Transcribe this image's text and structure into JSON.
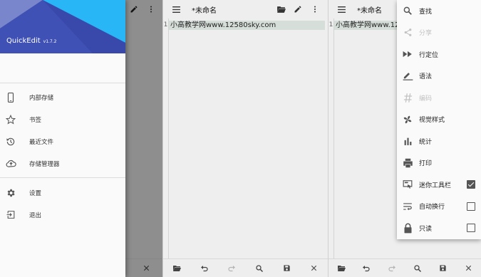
{
  "app": {
    "name": "QuickEdit",
    "version": "v1.7.2"
  },
  "drawer": {
    "storage_items": [
      {
        "label": "内部存储",
        "icon": "phone-icon"
      },
      {
        "label": "书签",
        "icon": "star-icon"
      },
      {
        "label": "最近文件",
        "icon": "history-icon"
      },
      {
        "label": "存储管理器",
        "icon": "cloud-upload-icon"
      }
    ],
    "other_items": [
      {
        "label": "设置",
        "icon": "gear-icon"
      },
      {
        "label": "退出",
        "icon": "exit-icon"
      }
    ]
  },
  "editors": [
    {
      "title": "*未命名",
      "line_number": "1",
      "line_text": "小高教学网www.12580sky.com"
    },
    {
      "title": "*未命名",
      "line_number": "1",
      "line_text": "小高教学网www.12580sky.com"
    }
  ],
  "menu": {
    "items": [
      {
        "label": "查找",
        "icon": "search-icon",
        "enabled": true
      },
      {
        "label": "分享",
        "icon": "share-icon",
        "enabled": false
      },
      {
        "label": "行定位",
        "icon": "fast-forward-icon",
        "enabled": true
      },
      {
        "label": "语法",
        "icon": "pen-icon",
        "enabled": true
      },
      {
        "label": "编码",
        "icon": "hash-icon",
        "enabled": false
      },
      {
        "label": "视觉样式",
        "icon": "pinwheel-icon",
        "enabled": true
      },
      {
        "label": "统计",
        "icon": "bar-chart-icon",
        "enabled": true
      },
      {
        "label": "打印",
        "icon": "printer-icon",
        "enabled": true
      },
      {
        "label": "迷你工具栏",
        "icon": "mini-toolbar-icon",
        "enabled": true,
        "checked": true
      },
      {
        "label": "自动换行",
        "icon": "wrap-icon",
        "enabled": true,
        "checked": false
      },
      {
        "label": "只读",
        "icon": "lock-icon",
        "enabled": true,
        "checked": false
      }
    ]
  },
  "colors": {
    "header": "#3f51b5",
    "header_light": "#5c6bc0",
    "line_highlight": "#d6ded9",
    "scrim": "rgba(0,0,0,0.38)"
  }
}
